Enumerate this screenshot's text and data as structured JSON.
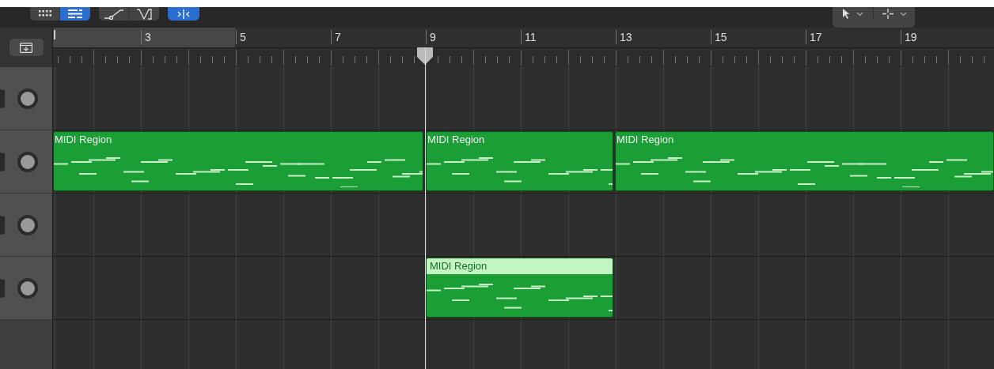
{
  "toolbar": {
    "view_buttons": [
      {
        "selected": false
      },
      {
        "selected": true
      }
    ],
    "edit_buttons": [
      {
        "selected": false
      },
      {
        "selected": false
      }
    ],
    "catch_button": {
      "selected": true
    }
  },
  "ruler": {
    "bars": [
      "3",
      "5",
      "7",
      "9",
      "11",
      "13",
      "15",
      "17",
      "19"
    ]
  },
  "tracks": [
    {
      "selected": false
    },
    {
      "selected": false,
      "regions": [
        {
          "name": "MIDI Region",
          "selected": false
        },
        {
          "name": "MIDI Region",
          "selected": false
        },
        {
          "name": "MIDI Region",
          "selected": false
        }
      ]
    },
    {
      "selected": false
    },
    {
      "selected": false,
      "regions": [
        {
          "name": "MIDI Region",
          "selected": true
        }
      ]
    }
  ]
}
